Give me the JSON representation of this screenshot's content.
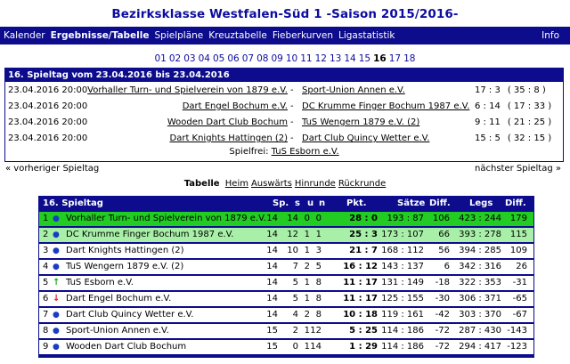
{
  "page_title": "Bezirksklasse Westfalen-Süd 1 -Saison 2015/2016-",
  "nav": {
    "items": [
      "Kalender",
      "Ergebnisse/Tabelle",
      "Spielpläne",
      "Kreuztabelle",
      "Fieberkurven",
      "Ligastatistik"
    ],
    "active": "Ergebnisse/Tabelle",
    "info": "Info"
  },
  "matchdays": {
    "items": [
      "01",
      "02",
      "03",
      "04",
      "05",
      "06",
      "07",
      "08",
      "09",
      "10",
      "11",
      "12",
      "13",
      "14",
      "15",
      "16",
      "17",
      "18"
    ],
    "current": "16"
  },
  "results": {
    "heading": "16. Spieltag vom 23.04.2016 bis 23.04.2016",
    "matches": [
      {
        "date": "23.04.2016 20:00",
        "home": "Vorhaller Turn- und Spielverein von 1879 e.V.",
        "away": "Sport-Union Annen e.V.",
        "score": "17 : 3",
        "legs": "( 35 : 8 )"
      },
      {
        "date": "23.04.2016 20:00",
        "home": "Dart Engel Bochum e.V.",
        "away": "DC Krumme Finger Bochum 1987 e.V.",
        "score": "6 : 14",
        "legs": "( 17 : 33 )"
      },
      {
        "date": "23.04.2016 20:00",
        "home": "Wooden Dart Club Bochum",
        "away": "TuS Wengern 1879 e.V. (2)",
        "score": "9 : 11",
        "legs": "( 21 : 25 )"
      },
      {
        "date": "23.04.2016 20:00",
        "home": "Dart Knights Hattingen (2)",
        "away": "Dart Club Quincy Wetter e.V.",
        "score": "15 : 5",
        "legs": "( 32 : 15 )"
      }
    ],
    "spielfrei_label": "Spielfrei:",
    "spielfrei_team": "TuS Esborn e.V."
  },
  "prev_label": "« vorheriger Spieltag",
  "next_label": "nächster Spieltag »",
  "table_links": {
    "label": "Tabelle",
    "links": [
      "Heim",
      "Auswärts",
      "Hinrunde",
      "Rückrunde"
    ]
  },
  "standings": {
    "headers": {
      "title": "16. Spieltag",
      "sp": "Sp.",
      "s": "s",
      "u": "u",
      "n": "n",
      "pkt": "Pkt.",
      "saetze": "Sätze",
      "diff": "Diff.",
      "legs": "Legs",
      "diff2": "Diff."
    },
    "rows": [
      {
        "pos": "1",
        "marker": "dot",
        "team": "Vorhaller Turn- und Spielverein von 1879 e.V.",
        "sp": "14",
        "s": "14",
        "u": "0",
        "n": "0",
        "pkt": "28 : 0",
        "saetze": "193 : 87",
        "diff": "106",
        "legs": "423 : 244",
        "diff2": "179"
      },
      {
        "pos": "2",
        "marker": "dot",
        "team": "DC Krumme Finger Bochum 1987 e.V.",
        "sp": "14",
        "s": "12",
        "u": "1",
        "n": "1",
        "pkt": "25 : 3",
        "saetze": "173 : 107",
        "diff": "66",
        "legs": "393 : 278",
        "diff2": "115"
      },
      {
        "pos": "3",
        "marker": "dot",
        "team": "Dart Knights Hattingen (2)",
        "sp": "14",
        "s": "10",
        "u": "1",
        "n": "3",
        "pkt": "21 : 7",
        "saetze": "168 : 112",
        "diff": "56",
        "legs": "394 : 285",
        "diff2": "109"
      },
      {
        "pos": "4",
        "marker": "dot",
        "team": "TuS Wengern 1879 e.V. (2)",
        "sp": "14",
        "s": "7",
        "u": "2",
        "n": "5",
        "pkt": "16 : 12",
        "saetze": "143 : 137",
        "diff": "6",
        "legs": "342 : 316",
        "diff2": "26"
      },
      {
        "pos": "5",
        "marker": "up",
        "team": "TuS Esborn e.V.",
        "sp": "14",
        "s": "5",
        "u": "1",
        "n": "8",
        "pkt": "11 : 17",
        "saetze": "131 : 149",
        "diff": "-18",
        "legs": "322 : 353",
        "diff2": "-31"
      },
      {
        "pos": "6",
        "marker": "down",
        "team": "Dart Engel Bochum e.V.",
        "sp": "14",
        "s": "5",
        "u": "1",
        "n": "8",
        "pkt": "11 : 17",
        "saetze": "125 : 155",
        "diff": "-30",
        "legs": "306 : 371",
        "diff2": "-65"
      },
      {
        "pos": "7",
        "marker": "dot",
        "team": "Dart Club Quincy Wetter e.V.",
        "sp": "14",
        "s": "4",
        "u": "2",
        "n": "8",
        "pkt": "10 : 18",
        "saetze": "119 : 161",
        "diff": "-42",
        "legs": "303 : 370",
        "diff2": "-67"
      },
      {
        "pos": "8",
        "marker": "dot",
        "team": "Sport-Union Annen e.V.",
        "sp": "15",
        "s": "2",
        "u": "1",
        "n": "12",
        "pkt": "5 : 25",
        "saetze": "114 : 186",
        "diff": "-72",
        "legs": "287 : 430",
        "diff2": "-143"
      },
      {
        "pos": "9",
        "marker": "dot",
        "team": "Wooden Dart Club Bochum",
        "sp": "15",
        "s": "0",
        "u": "1",
        "n": "14",
        "pkt": "1 : 29",
        "saetze": "114 : 186",
        "diff": "-72",
        "legs": "294 : 417",
        "diff2": "-123"
      }
    ]
  },
  "colors": {
    "navy": "#0c0c8c",
    "title_blue": "#0c0ca0",
    "leader_green": "#22cc22",
    "second_green": "#a8f0a8"
  }
}
